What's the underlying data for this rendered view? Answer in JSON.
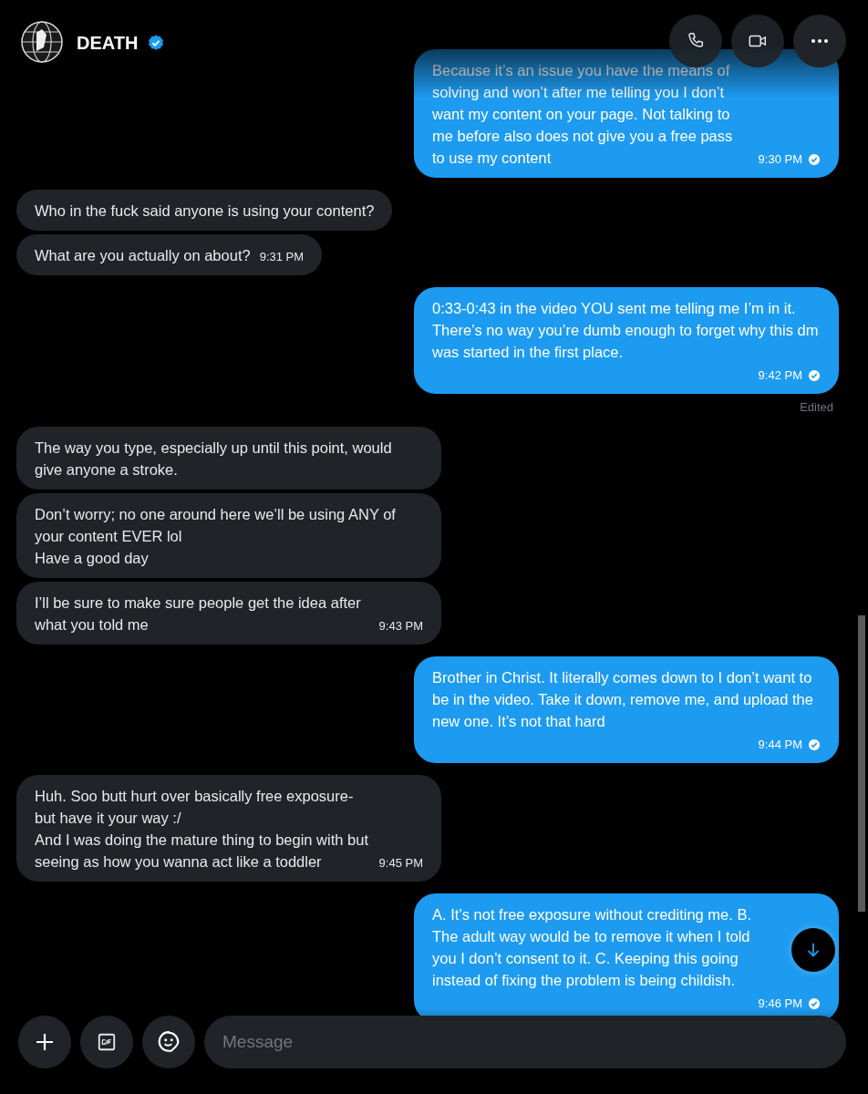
{
  "header": {
    "name": "DEATH",
    "verified": true
  },
  "messages": [
    {
      "outgoing": true,
      "kind": "end",
      "text": "Because it’s an issue you have the means of solving and won’t after me telling you I don’t want my content on your page. Not talking to me before also does not give you a free pass to use my content",
      "time": "9:30 PM",
      "read": true
    },
    {
      "outgoing": false,
      "kind": "plain",
      "text": "Who in the fuck said anyone is using your content?"
    },
    {
      "outgoing": false,
      "kind": "inline",
      "text": "What are you actually on about?",
      "time": "9:31 PM"
    },
    {
      "outgoing": true,
      "kind": "below",
      "text": "0:33-0:43 in the video YOU sent me telling me I’m in it. There’s no way you’re dumb enough to forget why this dm was started in the first place.",
      "time": "9:42 PM",
      "read": true,
      "note": "Edited"
    },
    {
      "outgoing": false,
      "kind": "plain",
      "text": "The way you type, especially up until this point, would give anyone a stroke."
    },
    {
      "outgoing": false,
      "kind": "plain",
      "text": "Don’t worry; no one around here we’ll be using ANY of your content EVER lol\nHave a good day"
    },
    {
      "outgoing": false,
      "kind": "end",
      "text": "I’ll be sure to make sure people get the idea after what you told me",
      "time": "9:43 PM"
    },
    {
      "outgoing": true,
      "kind": "below",
      "text": "Brother in Christ. It literally comes down to I don’t want to be in the video. Take it down, remove me, and upload the new one. It’s not that hard",
      "time": "9:44 PM",
      "read": true
    },
    {
      "outgoing": false,
      "kind": "inline",
      "text": "Huh. Soo butt hurt over basically free exposure- but have it your way :/\nAnd I was doing the mature thing to begin with but seeing as how you wanna act like a toddler",
      "time": "9:45 PM"
    },
    {
      "outgoing": true,
      "kind": "below",
      "text": "A. It’s not free exposure without crediting me. B. The adult way would be to remove it when I told you I don’t consent to it. C. Keeping this going instead of fixing the problem is being childish.",
      "time": "9:46 PM",
      "read": true
    }
  ],
  "composer": {
    "placeholder": "Message"
  }
}
